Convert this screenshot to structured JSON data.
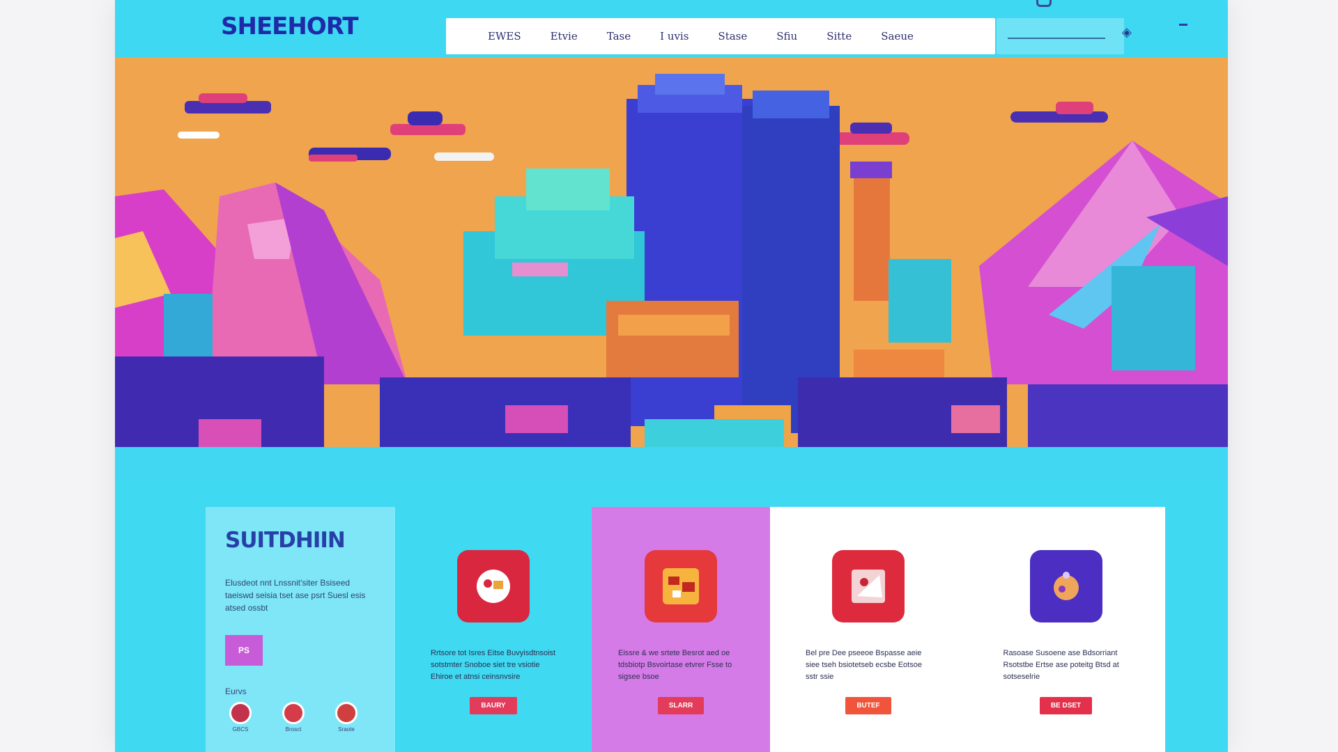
{
  "header": {
    "logo": "SHEEHORT",
    "nav": [
      "EWES",
      "Etvie",
      "Tase",
      "I uvis",
      "Stase",
      "Sfiu",
      "Sitte",
      "Saeue"
    ]
  },
  "search": {
    "value": "",
    "placeholder": ""
  },
  "intro": {
    "title": "SUITDHIIN",
    "text": "Elusdeot nnt Lnssnit'siter Bsiseed taeiswd seisia tset ase psrt Suesl esis atsed ossbt",
    "button_label": "PS",
    "sub_label": "Eurvs",
    "avatars": [
      "GBCS",
      "Brosct",
      "Sraote"
    ]
  },
  "cards": [
    {
      "text": "Rrtsore tot Isres Eitse Buvyisdtnsoist sotstmter Snoboe siet tre vsiotie Ehiroe et atnsi ceinsnvsire",
      "button_label": "BAURY"
    },
    {
      "text": "Eissre & we srtete Besrot aed oe tdsbiotp Bsvoirtase etvrer Fsse to sigsee bsoe",
      "button_label": "SLARR"
    },
    {
      "text": "Bel pre Dee pseeoe Bspasse aeie siee tseh bsiotetseb ecsbe Eotsoe sstr ssie",
      "button_label": "BUTEF"
    },
    {
      "text": "Rasoase Susoene ase Bdsorriant Rsotstbe Ertse ase poteitg Btsd at sotseselrie",
      "button_label": "BE DSET"
    }
  ],
  "colors": {
    "frame_bg": "#3fd9f2",
    "logo": "#1f2aa8",
    "sky": "#f0a44e",
    "card1_bg": "#3fd9f2",
    "card2_bg": "#d57be8",
    "card3_bg": "#ffffff",
    "card4_bg": "#ffffff",
    "card1_btn": "#e33b5a",
    "card2_btn": "#e33b5a",
    "card3_btn": "#f0553c",
    "card4_btn": "#e3304b"
  }
}
